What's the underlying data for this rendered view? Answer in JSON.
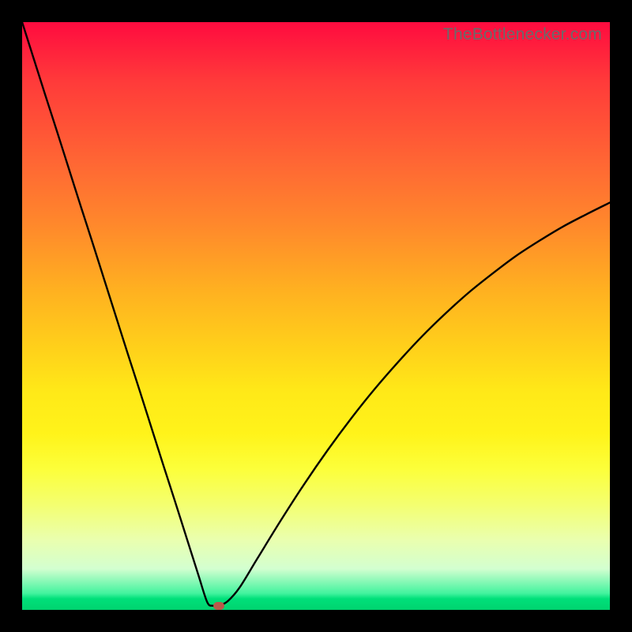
{
  "attribution": "TheBottlenecker.com",
  "chart_data": {
    "type": "line",
    "title": "",
    "xlabel": "",
    "ylabel": "",
    "xlim": [
      0,
      100
    ],
    "ylim": [
      0,
      100
    ],
    "x": [
      0,
      2,
      4,
      6,
      8,
      10,
      12,
      14,
      16,
      18,
      20,
      22,
      24,
      26,
      28,
      30,
      31.5,
      32.5,
      33.5,
      35,
      37,
      40,
      44,
      48,
      52,
      56,
      60,
      64,
      68,
      72,
      76,
      80,
      84,
      88,
      92,
      96,
      100
    ],
    "values": [
      100,
      93.7,
      87.4,
      81.2,
      74.9,
      68.6,
      62.4,
      56.1,
      49.8,
      43.5,
      37.3,
      31.0,
      24.7,
      18.5,
      12.2,
      5.9,
      1.3,
      0.7,
      0.7,
      1.5,
      3.8,
      8.7,
      15.2,
      21.4,
      27.2,
      32.6,
      37.6,
      42.2,
      46.5,
      50.4,
      54.0,
      57.2,
      60.2,
      62.8,
      65.2,
      67.3,
      69.3
    ],
    "marker": {
      "x": 33.5,
      "y": 0.7
    },
    "gradient_background": {
      "stops": [
        {
          "pos": 0.0,
          "color": "#ff0b3f"
        },
        {
          "pos": 0.1,
          "color": "#ff3a3a"
        },
        {
          "pos": 0.25,
          "color": "#ff6a33"
        },
        {
          "pos": 0.35,
          "color": "#ff8a2b"
        },
        {
          "pos": 0.46,
          "color": "#ffb220"
        },
        {
          "pos": 0.56,
          "color": "#ffd21a"
        },
        {
          "pos": 0.63,
          "color": "#ffe918"
        },
        {
          "pos": 0.7,
          "color": "#fff31a"
        },
        {
          "pos": 0.76,
          "color": "#fcff3a"
        },
        {
          "pos": 0.82,
          "color": "#f4ff6f"
        },
        {
          "pos": 0.88,
          "color": "#eaffae"
        },
        {
          "pos": 0.93,
          "color": "#d3ffd0"
        },
        {
          "pos": 0.972,
          "color": "#42f39e"
        },
        {
          "pos": 0.981,
          "color": "#00e07a"
        },
        {
          "pos": 1.0,
          "color": "#00d36f"
        }
      ]
    },
    "line_color": "#000000",
    "marker_color": "#b95a4a"
  }
}
